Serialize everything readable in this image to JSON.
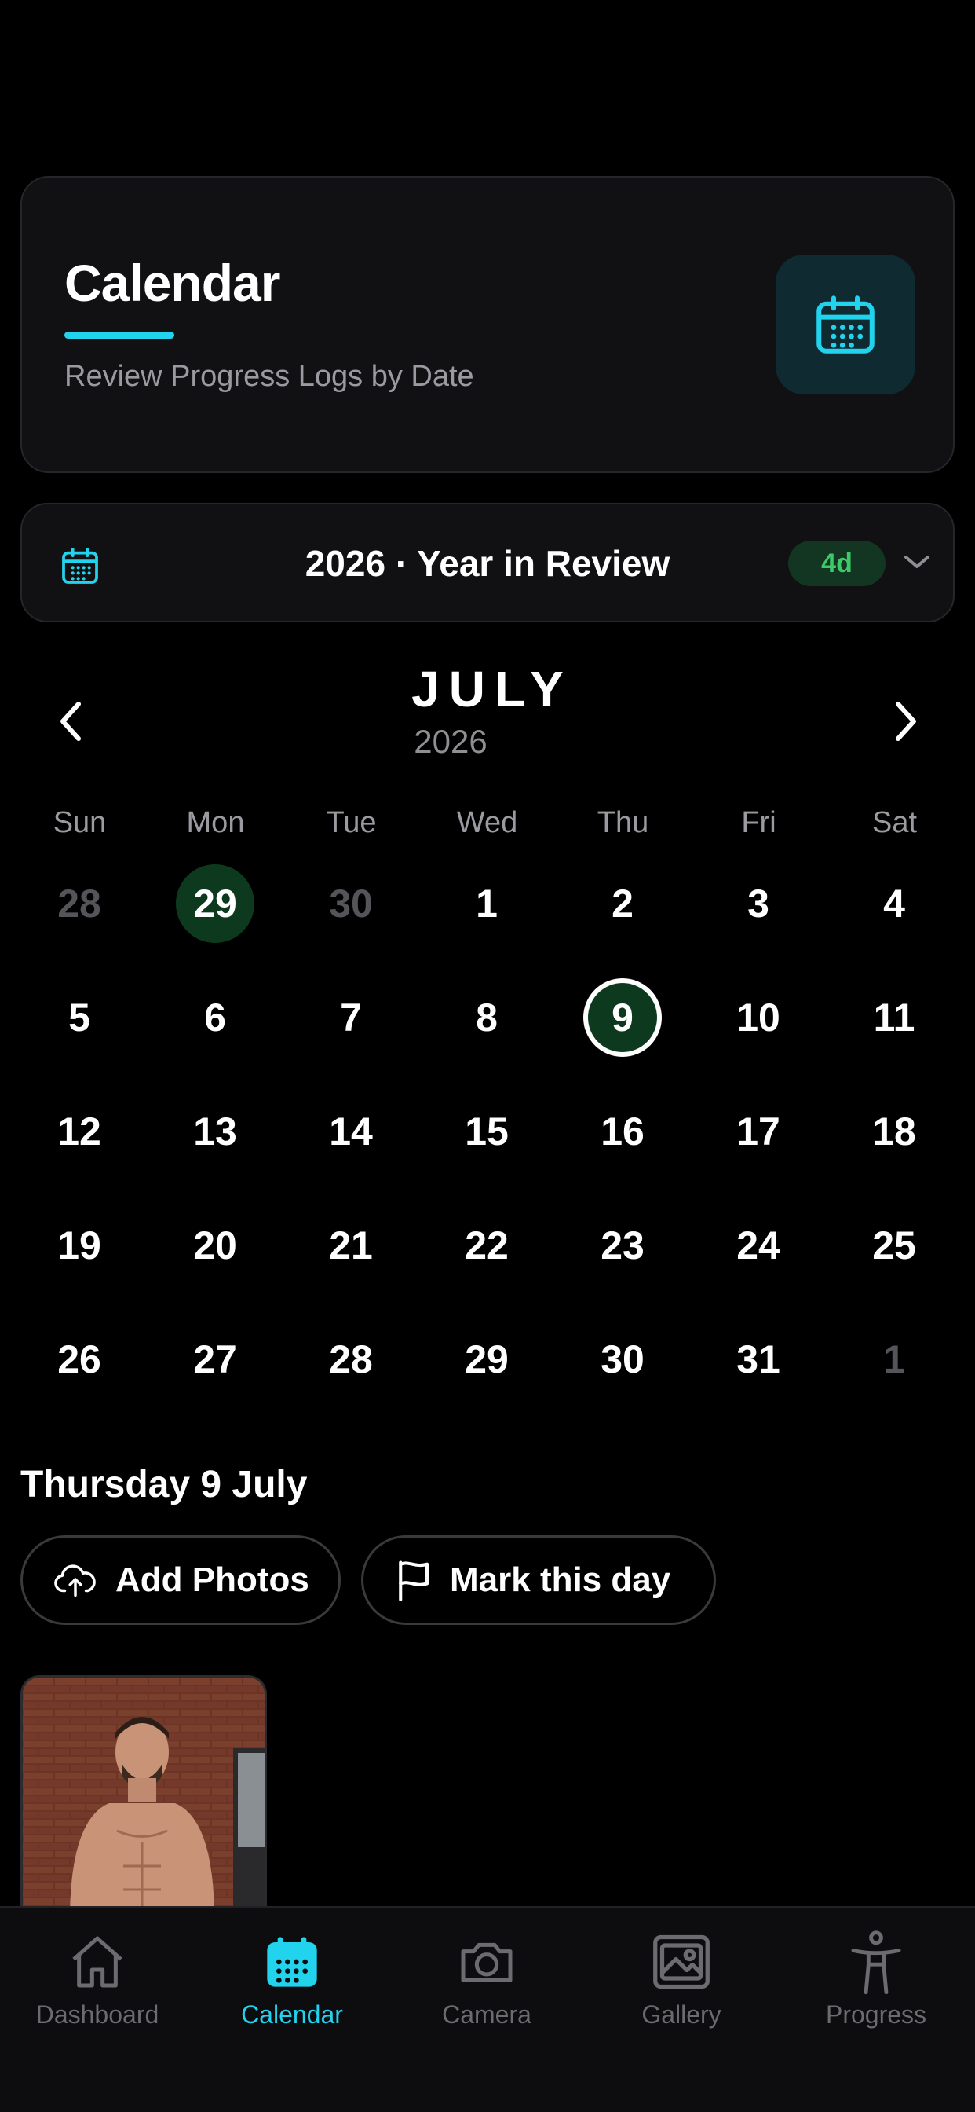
{
  "header": {
    "title": "Calendar",
    "subtitle": "Review Progress Logs by Date",
    "icon": "calendar-icon",
    "accent_color": "#22d3ee"
  },
  "year_review": {
    "title": "2026 · Year in Review",
    "badge": "4d",
    "icon": "calendar-icon",
    "chevron": "chevron-down-icon"
  },
  "month": {
    "name": "JULY",
    "year": "2026"
  },
  "weekdays": [
    "Sun",
    "Mon",
    "Tue",
    "Wed",
    "Thu",
    "Fri",
    "Sat"
  ],
  "days": [
    {
      "label": "28",
      "muted": true
    },
    {
      "label": "29",
      "marked": true
    },
    {
      "label": "30",
      "muted": true
    },
    {
      "label": "1"
    },
    {
      "label": "2"
    },
    {
      "label": "3"
    },
    {
      "label": "4"
    },
    {
      "label": "5"
    },
    {
      "label": "6"
    },
    {
      "label": "7"
    },
    {
      "label": "8"
    },
    {
      "label": "9",
      "today": true
    },
    {
      "label": "10"
    },
    {
      "label": "11"
    },
    {
      "label": "12"
    },
    {
      "label": "13"
    },
    {
      "label": "14"
    },
    {
      "label": "15"
    },
    {
      "label": "16"
    },
    {
      "label": "17"
    },
    {
      "label": "18"
    },
    {
      "label": "19"
    },
    {
      "label": "20"
    },
    {
      "label": "21"
    },
    {
      "label": "22"
    },
    {
      "label": "23"
    },
    {
      "label": "24"
    },
    {
      "label": "25"
    },
    {
      "label": "26"
    },
    {
      "label": "27"
    },
    {
      "label": "28"
    },
    {
      "label": "29"
    },
    {
      "label": "30"
    },
    {
      "label": "31"
    },
    {
      "label": "1",
      "muted": true
    }
  ],
  "selected_date": "Thursday 9 July",
  "actions": {
    "add_photos": "Add Photos",
    "mark_day": "Mark this day"
  },
  "tabs": [
    {
      "label": "Dashboard",
      "icon": "home-icon"
    },
    {
      "label": "Calendar",
      "icon": "calendar-icon",
      "active": true
    },
    {
      "label": "Camera",
      "icon": "camera-icon"
    },
    {
      "label": "Gallery",
      "icon": "gallery-icon"
    },
    {
      "label": "Progress",
      "icon": "person-icon"
    }
  ]
}
